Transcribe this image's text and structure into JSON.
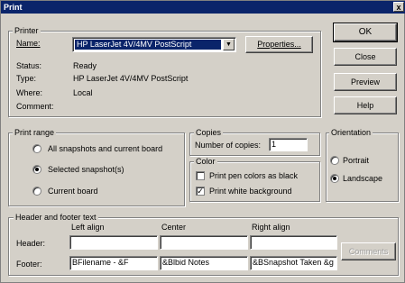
{
  "titlebar": {
    "title": "Print",
    "close_glyph": "x"
  },
  "printer": {
    "legend": "Printer",
    "name_label": "Name:",
    "name_value": "HP LaserJet 4V/4MV PostScript",
    "properties_label": "Properties...",
    "status_label": "Status:",
    "status_value": "Ready",
    "type_label": "Type:",
    "type_value": "HP LaserJet 4V/4MV PostScript",
    "where_label": "Where:",
    "where_value": "Local",
    "comment_label": "Comment:"
  },
  "buttons": {
    "ok": "OK",
    "close": "Close",
    "preview": "Preview",
    "help": "Help",
    "comments": "Comments"
  },
  "print_range": {
    "legend": "Print range",
    "options": [
      "All snapshots and current board",
      "Selected snapshot(s)",
      "Current board"
    ],
    "selected_index": 1
  },
  "copies": {
    "legend": "Copies",
    "label": "Number of copies:",
    "value": "1"
  },
  "color": {
    "legend": "Color",
    "pen_colors_label": "Print pen colors as black",
    "pen_colors_checked": false,
    "white_bg_label": "Print white background",
    "white_bg_checked": true
  },
  "orientation": {
    "legend": "Orientation",
    "options": [
      "Portrait",
      "Landscape"
    ],
    "selected_index": 1
  },
  "header_footer": {
    "legend": "Header and footer text",
    "col_left": "Left align",
    "col_center": "Center",
    "col_right": "Right align",
    "header_label": "Header:",
    "footer_label": "Footer:",
    "header": [
      "",
      "",
      ""
    ],
    "footer": [
      "BFilename - &F",
      "&Blbid Notes",
      "&BSnapshot Taken &g"
    ]
  }
}
